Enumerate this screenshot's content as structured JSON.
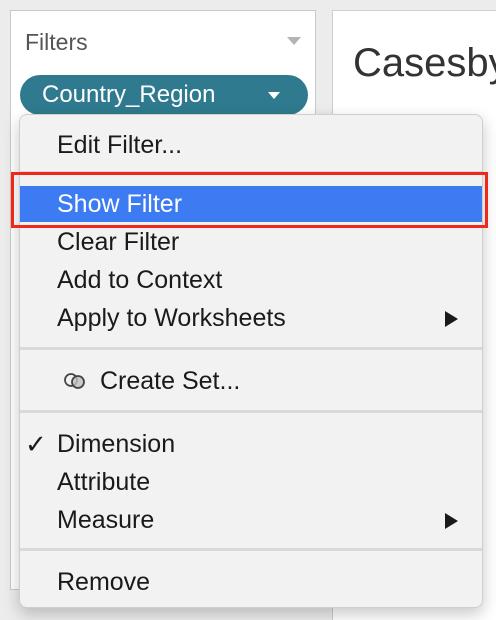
{
  "filters_shelf": {
    "title": "Filters",
    "pill_label": "Country_Region"
  },
  "worksheet": {
    "title": "Casesby"
  },
  "context_menu": {
    "items": [
      {
        "label": "Edit Filter..."
      },
      {
        "label": "Show Filter",
        "selected": true
      },
      {
        "label": "Clear Filter"
      },
      {
        "label": "Add to Context"
      },
      {
        "label": "Apply to Worksheets",
        "has_submenu": true
      },
      {
        "label": "Create Set...",
        "icon": "set-icon"
      },
      {
        "label": "Dimension",
        "checked": true
      },
      {
        "label": "Attribute"
      },
      {
        "label": "Measure",
        "has_submenu": true
      },
      {
        "label": "Remove"
      }
    ],
    "check_glyph": "✓"
  },
  "colors": {
    "accent_selection": "#3d7bf2",
    "pill": "#2f7a8f",
    "highlight_box": "#f0281c"
  }
}
